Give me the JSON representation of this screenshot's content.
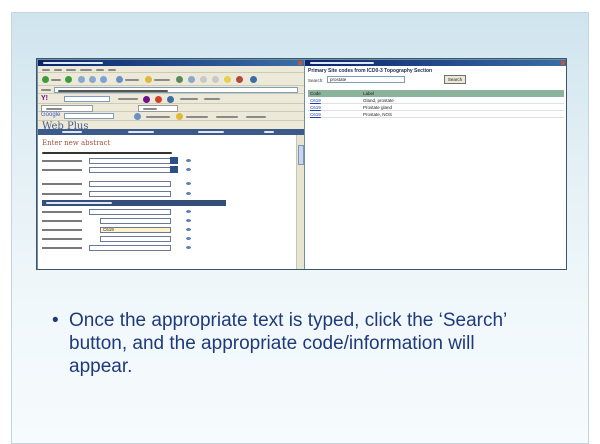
{
  "right_window": {
    "heading": "Primary Site codes from ICD0-3 Topography Section",
    "search": {
      "label": "Search:",
      "value": "prostate",
      "button": "Search"
    },
    "table": {
      "headers": [
        "Code",
        "Label"
      ],
      "rows": [
        {
          "code": "C619",
          "label": "Gland, prostate"
        },
        {
          "code": "C619",
          "label": "Prostate gland"
        },
        {
          "code": "C619",
          "label": "Prostate, NOS"
        }
      ]
    }
  },
  "left_window": {
    "logo": "Web Plus",
    "form_heading": "Enter new abstract",
    "icons": {
      "back": "back-arrow-icon",
      "forward": "forward-arrow-icon",
      "stop": "stop-icon",
      "refresh": "refresh-icon",
      "home": "home-icon",
      "search": "search-icon",
      "favorites": "favorites-star-icon",
      "dropdown": "dropdown-arrow-icon",
      "lookup": "lookup-eye-icon"
    }
  },
  "slide": {
    "bullet_text": "Once the appropriate text is typed, click the ‘Search’ button, and the appropriate code/information will appear."
  },
  "colors": {
    "slide_bg_top": "#cfe4ee",
    "bullet_text": "#1f3a7a",
    "table_header": "#8bb39b",
    "title_bar": "#0a246a"
  }
}
